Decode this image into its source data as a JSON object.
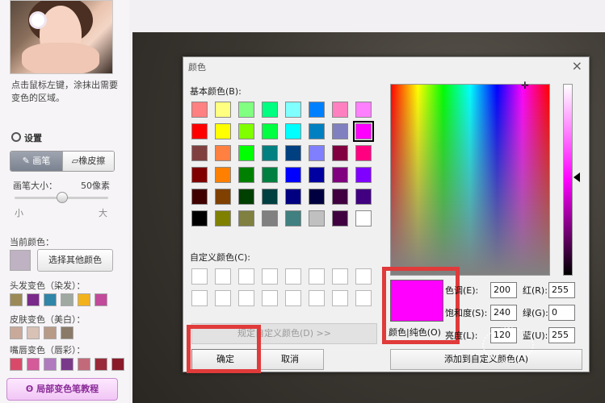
{
  "left_panel": {
    "hint": "点击鼠标左键，涂抹出需要变色的区域。",
    "settings_label": "设置",
    "tool_brush": "画笔",
    "tool_eraser": "橡皮擦",
    "brush_size_label": "画笔大小：",
    "brush_size_value": "50像素",
    "brush_size_level": 0.5,
    "slider_min": "小",
    "slider_max": "大",
    "current_color_label": "当前颜色：",
    "current_color": "#bfb2c2",
    "pick_other_btn": "选择其他颜色",
    "hair_label": "头发变色（染发）：",
    "hair_colors": [
      "#9b8a55",
      "#7a2a8a",
      "#2f86a8",
      "#a0a8a2",
      "#f2b21e",
      "#c14a9a"
    ],
    "skin_label": "皮肤变色（美白）：",
    "skin_colors": [
      "#c9a99a",
      "#d8c2b6",
      "#b89a88",
      "#8a7a68"
    ],
    "lip_label": "嘴唇变色（唇彩）：",
    "lip_colors": [
      "#d94a6a",
      "#d45a9a",
      "#b07abf",
      "#7a3a8a",
      "#c26a7a",
      "#9a2a3a",
      "#8a1a2a"
    ],
    "tutorial_btn": "局部变色笔教程"
  },
  "dialog": {
    "title": "颜色",
    "close": "×",
    "basic_colors_label": "基本颜色(B):",
    "basic_colors": [
      [
        "#ff8080",
        "#ffff80",
        "#80ff80",
        "#00ff80",
        "#80ffff",
        "#0080ff",
        "#ff80c0",
        "#ff80ff"
      ],
      [
        "#ff0000",
        "#ffff00",
        "#80ff00",
        "#00ff40",
        "#00ffff",
        "#0080c0",
        "#8080c0",
        "#ff00ff"
      ],
      [
        "#804040",
        "#ff8040",
        "#00ff00",
        "#008080",
        "#004080",
        "#8080ff",
        "#800040",
        "#ff0080"
      ],
      [
        "#800000",
        "#ff8000",
        "#008000",
        "#008040",
        "#0000ff",
        "#0000a0",
        "#800080",
        "#8000ff"
      ],
      [
        "#400000",
        "#804000",
        "#004000",
        "#004040",
        "#000080",
        "#000040",
        "#400040",
        "#400080"
      ],
      [
        "#000000",
        "#808000",
        "#808040",
        "#808080",
        "#408080",
        "#c0c0c0",
        "#400040",
        "#ffffff"
      ]
    ],
    "selected_basic": "#ff00ff",
    "custom_colors_label": "自定义颜色(C):",
    "define_custom_btn": "规定自定义颜色(D) >>",
    "ok_btn": "确定",
    "cancel_btn": "取消",
    "preview_label": "颜色|纯色(O)",
    "preview_color": "#ff00ff",
    "hue_label": "色调(E):",
    "hue_value": "200",
    "sat_label": "饱和度(S):",
    "sat_value": "240",
    "lum_label": "亮度(L):",
    "lum_value": "120",
    "red_label": "红(R):",
    "red_value": "255",
    "green_label": "绿(G):",
    "green_value": "0",
    "blue_label": "蓝(U):",
    "blue_value": "255",
    "add_custom_btn": "添加到自定义颜色(A)",
    "highlight_color": "#e03a3a"
  }
}
